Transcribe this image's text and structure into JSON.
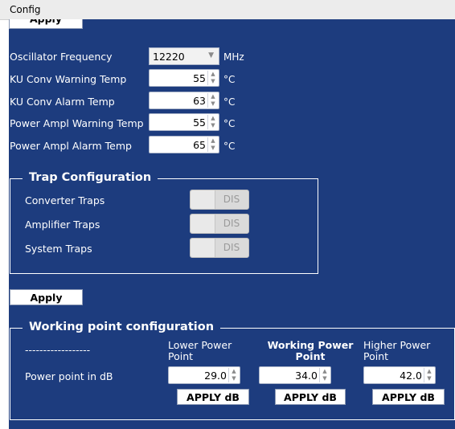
{
  "window": {
    "title": "Config"
  },
  "top_apply": {
    "label": "Apply"
  },
  "oscillator": {
    "label": "Oscillator Frequency",
    "value": "12220",
    "unit": "MHz"
  },
  "temps": [
    {
      "label": "KU Conv Warning Temp",
      "value": "55",
      "unit": "°C"
    },
    {
      "label": "KU Conv Alarm Temp",
      "value": "63",
      "unit": "°C"
    },
    {
      "label": "Power Ampl Warning Temp",
      "value": "55",
      "unit": "°C"
    },
    {
      "label": "Power Ampl Alarm Temp",
      "value": "65",
      "unit": "°C"
    }
  ],
  "trap_config": {
    "legend": "Trap Configuration",
    "items": [
      {
        "label": "Converter Traps",
        "state": "DIS"
      },
      {
        "label": "Amplifier Traps",
        "state": "DIS"
      },
      {
        "label": "System Traps",
        "state": "DIS"
      }
    ]
  },
  "apply": {
    "label": "Apply"
  },
  "working_point": {
    "legend": "Working point configuration",
    "placeholder_col": "------------------",
    "row_label": "Power point in dB",
    "columns": [
      {
        "label": "Lower Power Point",
        "value": "29.0",
        "button": "APPLY dB"
      },
      {
        "label": "Working Power Point",
        "value": "34.0",
        "button": "APPLY dB"
      },
      {
        "label": "Higher Power Point",
        "value": "42.0",
        "button": "APPLY dB"
      }
    ]
  }
}
